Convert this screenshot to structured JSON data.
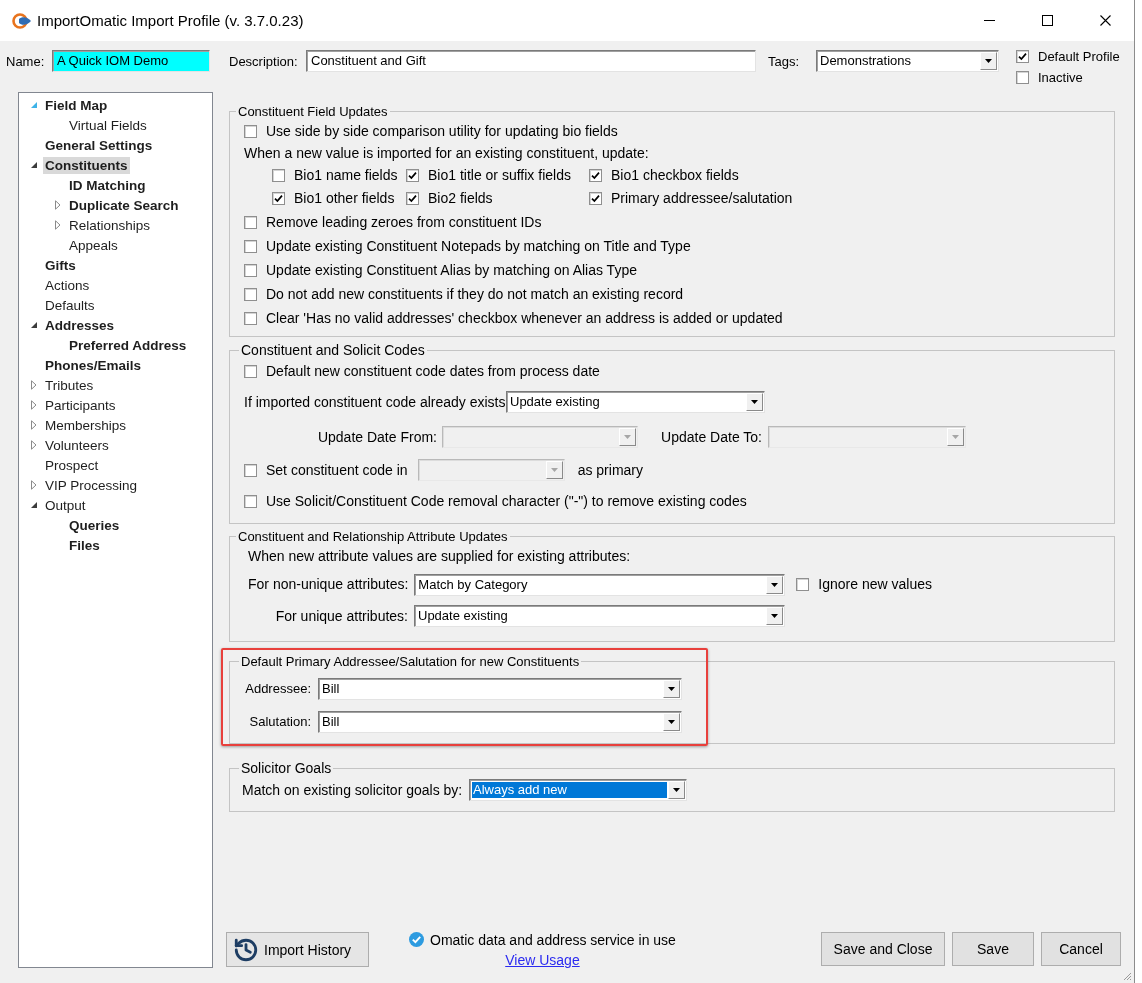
{
  "window": {
    "title": "ImportOmatic Import Profile (v. 3.7.0.23)"
  },
  "header": {
    "name": {
      "label": "Name:",
      "value": "A Quick IOM Demo"
    },
    "description": {
      "label": "Description:",
      "value": "Constituent and Gift"
    },
    "tags": {
      "label": "Tags:",
      "value": "Demonstrations"
    },
    "flags": [
      {
        "label": "Default Profile",
        "checked": true
      },
      {
        "label": "Inactive",
        "checked": false
      }
    ]
  },
  "sidebar": {
    "items": [
      {
        "label": "Field Map",
        "bold": true,
        "selected": false,
        "expanded": true,
        "hovered": true,
        "children": [
          {
            "label": "Virtual Fields",
            "bold": false,
            "selected": false
          }
        ]
      },
      {
        "label": "General Settings",
        "bold": true,
        "selected": false
      },
      {
        "label": "Constituents",
        "bold": true,
        "selected": true,
        "expanded": true,
        "hovered": false,
        "children": [
          {
            "label": "ID Matching",
            "bold": true,
            "selected": false
          },
          {
            "label": "Duplicate Search",
            "bold": true,
            "selected": false,
            "expanded": false,
            "hovered": false
          },
          {
            "label": "Relationships",
            "bold": false,
            "selected": false,
            "expanded": false,
            "hovered": false
          },
          {
            "label": "Appeals",
            "bold": false,
            "selected": false
          }
        ]
      },
      {
        "label": "Gifts",
        "bold": true,
        "selected": false
      },
      {
        "label": "Actions",
        "bold": false,
        "selected": false
      },
      {
        "label": "Defaults",
        "bold": false,
        "selected": false
      },
      {
        "label": "Addresses",
        "bold": true,
        "selected": false,
        "expanded": true,
        "hovered": false,
        "children": [
          {
            "label": "Preferred Address",
            "bold": true,
            "selected": false
          }
        ]
      },
      {
        "label": "Phones/Emails",
        "bold": true,
        "selected": false
      },
      {
        "label": "Tributes",
        "bold": false,
        "selected": false,
        "expanded": false,
        "hovered": false
      },
      {
        "label": "Participants",
        "bold": false,
        "selected": false,
        "expanded": false,
        "hovered": false
      },
      {
        "label": "Memberships",
        "bold": false,
        "selected": false,
        "expanded": false,
        "hovered": false
      },
      {
        "label": "Volunteers",
        "bold": false,
        "selected": false,
        "expanded": false,
        "hovered": false
      },
      {
        "label": "Prospect",
        "bold": false,
        "selected": false
      },
      {
        "label": "VIP Processing",
        "bold": false,
        "selected": false,
        "expanded": false,
        "hovered": false
      },
      {
        "label": "Output",
        "bold": false,
        "selected": false,
        "expanded": true,
        "hovered": false,
        "children": [
          {
            "label": "Queries",
            "bold": true,
            "selected": false
          },
          {
            "label": "Files",
            "bold": true,
            "selected": false
          }
        ]
      }
    ]
  },
  "field_updates": {
    "title": "Constituent Field Updates",
    "rows": [
      {
        "kind": "checkbox",
        "label": "Use side by side comparison utility for updating bio fields",
        "checked": false
      },
      {
        "kind": "text",
        "label": "When a new value is imported for an existing constituent, update:"
      },
      {
        "kind": "grid",
        "items": [
          {
            "label": "Bio1 name fields",
            "checked": false
          },
          {
            "label": "Bio1 title or suffix fields",
            "checked": true
          },
          {
            "label": "Bio1 checkbox fields",
            "checked": true
          },
          {
            "label": "Bio1 other fields",
            "checked": true
          },
          {
            "label": "Bio2 fields",
            "checked": true
          },
          {
            "label": "Primary addressee/salutation",
            "checked": true
          }
        ]
      },
      {
        "kind": "checkbox",
        "label": "Remove leading zeroes from constituent IDs",
        "checked": false
      },
      {
        "kind": "checkbox",
        "label": "Update existing Constituent Notepads by matching on Title and Type",
        "checked": false
      },
      {
        "kind": "checkbox",
        "label": "Update existing Constituent Alias by matching on Alias Type",
        "checked": false
      },
      {
        "kind": "checkbox",
        "label": "Do not add new constituents if they do not match an existing record",
        "checked": false
      },
      {
        "kind": "checkbox",
        "label": "Clear 'Has no valid addresses' checkbox whenever an address is added or updated",
        "checked": false
      }
    ]
  },
  "solicit_codes": {
    "title": "Constituent and Solicit Codes",
    "default_dates": {
      "label": "Default new constituent code dates from process date",
      "checked": false
    },
    "existing_code": {
      "label": "If imported constituent code already exists",
      "value": "Update existing"
    },
    "date_from": {
      "label": "Update Date From:",
      "disabled": true
    },
    "date_to": {
      "label": "Update Date To:",
      "disabled": true
    },
    "set_primary": {
      "label": "Set constituent code in",
      "checked": false,
      "combo_disabled": true,
      "suffix": "as primary"
    },
    "removal_character": {
      "label": "Use Solicit/Constituent Code removal character (\"-\") to remove existing codes",
      "checked": false
    }
  },
  "attribute_updates": {
    "title": "Constituent and Relationship Attribute Updates",
    "intro": "When new attribute values are supplied for existing attributes:",
    "non_unique": {
      "label": "For non-unique attributes:",
      "value": "Match by Category"
    },
    "ignore_new": {
      "label": "Ignore new values",
      "checked": false
    },
    "unique": {
      "label": "For unique attributes:",
      "value": "Update existing"
    }
  },
  "default_addressee": {
    "title": "Default Primary Addressee/Salutation for new Constituents",
    "highlighted": true,
    "fields": [
      {
        "label": "Addressee:",
        "value": "Bill"
      },
      {
        "label": "Salutation:",
        "value": "Bill"
      }
    ]
  },
  "solicitor_goals": {
    "title": "Solicitor Goals",
    "match": {
      "label": "Match on existing solicitor goals by:",
      "value": "Always add new",
      "focused": true
    }
  },
  "footer": {
    "history_button": "Import History",
    "service_status": "Omatic data and address service in use",
    "usage_link": "View Usage",
    "buttons": [
      "Save and Close",
      "Save",
      "Cancel"
    ]
  }
}
